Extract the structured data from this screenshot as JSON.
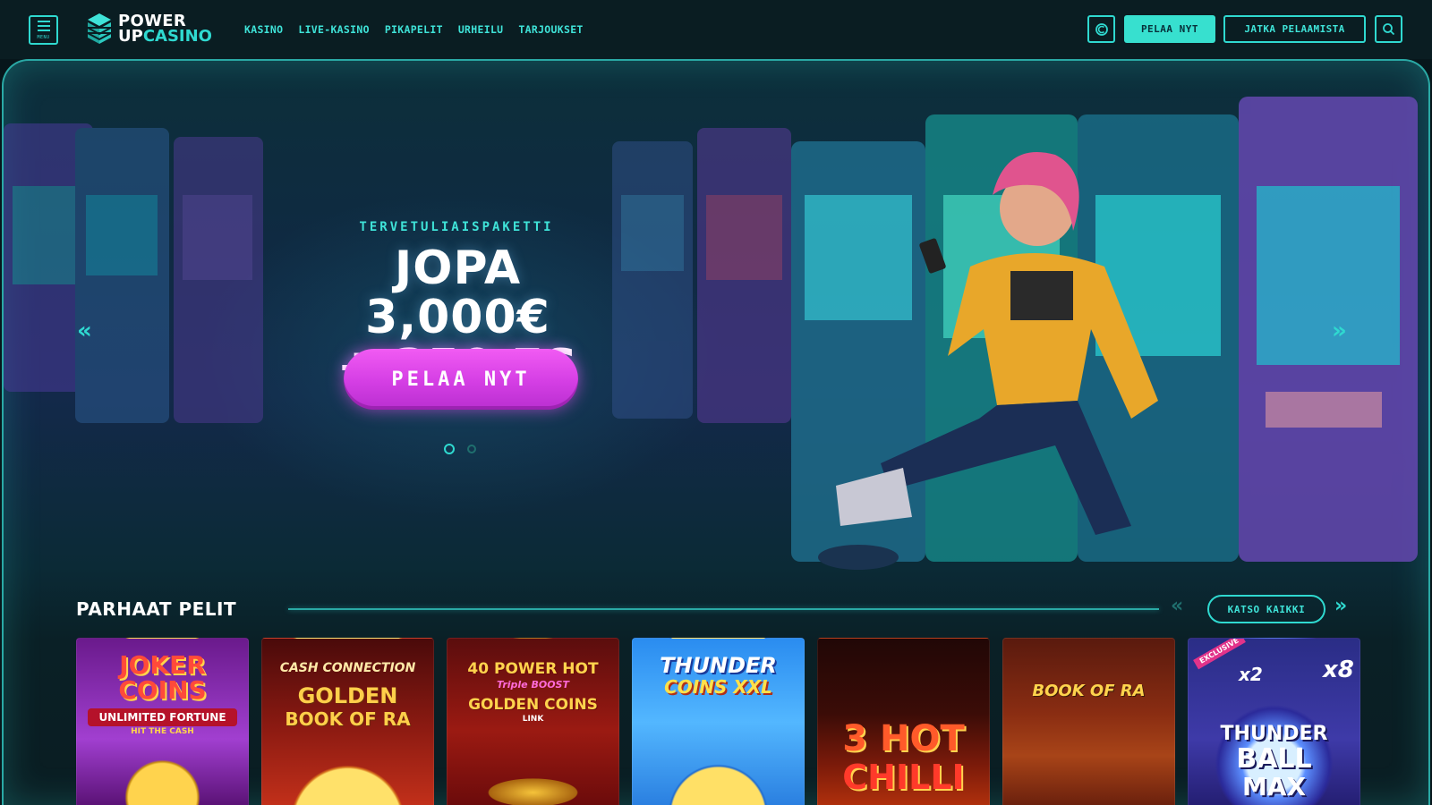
{
  "header": {
    "menu_label": "MENU",
    "logo": {
      "line1": "POWER",
      "line2a": "UP",
      "line2b": "CASINO"
    },
    "nav": [
      "KASINO",
      "LIVE-KASINO",
      "PIKAPELIT",
      "URHEILU",
      "TARJOUKSET"
    ],
    "play_now": "PELAA NYT",
    "continue_playing": "JATKA PELAAMISTA"
  },
  "hero": {
    "kicker": "TERVETULIAISPAKETTI",
    "title_line1": "JOPA",
    "title_line2": "3,000€",
    "title_line3": "+ 350 FS",
    "cta": "PELAA NYT",
    "prev_arrow": "«",
    "next_arrow": "»",
    "slides_total": 2,
    "slide_active": 1
  },
  "section": {
    "title": "PARHAAT PELIT",
    "see_all": "KATSO KAIKKI",
    "prev": "«",
    "next": "»"
  },
  "games": [
    {
      "title_a": "JOKER",
      "title_b": "COINS",
      "subtitle": "UNLIMITED FORTUNE",
      "tag": "HIT THE CASH"
    },
    {
      "title_a": "CASH CONNECTION",
      "title_b": "GOLDEN",
      "subtitle": "BOOK OF RA"
    },
    {
      "title_a": "40 POWER HOT",
      "title_b": "Triple BOOST",
      "subtitle": "GOLDEN COINS",
      "tag": "LINK"
    },
    {
      "title_a": "THUNDER",
      "title_b": "COINS XXL"
    },
    {
      "title_a": "3 HOT",
      "title_b": "CHILLI"
    },
    {
      "title_a": "BOOK OF RA"
    },
    {
      "badge": "EXCLUSIVE",
      "title_a": "THUNDER",
      "title_b": "BALL",
      "subtitle": "MAX",
      "mult_a": "x2",
      "mult_b": "x8"
    }
  ],
  "colors": {
    "accent": "#2fd9d0",
    "cta": "#d43ee4",
    "background": "#07161b"
  }
}
